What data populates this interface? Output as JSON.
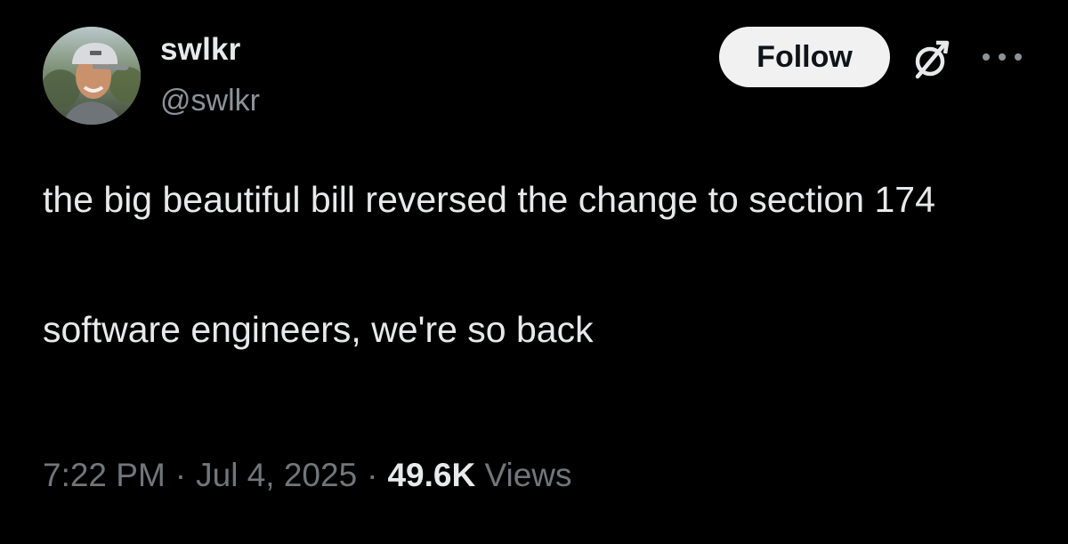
{
  "author": {
    "display_name": "swlkr",
    "handle": "@swlkr",
    "avatar_icon": "user-avatar"
  },
  "header": {
    "follow_label": "Follow",
    "grok_icon": "grok-slash-circle-icon",
    "more_icon": "more-horizontal-icon"
  },
  "tweet": {
    "paragraphs": [
      "the big beautiful bill reversed the change to section 174",
      "software engineers, we're so back"
    ]
  },
  "meta": {
    "time": "7:22 PM",
    "separator": "·",
    "date": "Jul 4, 2025",
    "views_count": "49.6K",
    "views_label": "Views"
  },
  "colors": {
    "background": "#000000",
    "primary_text": "#e7e9ea",
    "secondary_text": "#71767b",
    "follow_button_bg": "#f1f1f1",
    "follow_button_text": "#0f1419"
  }
}
